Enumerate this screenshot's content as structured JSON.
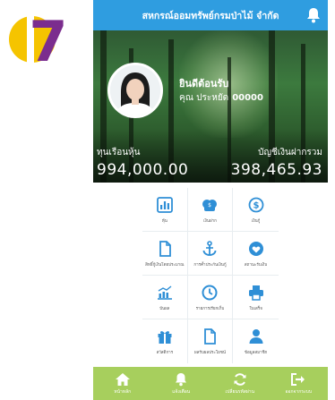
{
  "step_number": "7",
  "header": {
    "title": "สหกรณ์ออมทรัพย์กรมป่าไม้ จำกัด"
  },
  "profile": {
    "welcome": "ยินดีต้อนรับ",
    "member_prefix": "คุณ ประหยัด",
    "member_id": "00000"
  },
  "balances": {
    "share_label": "ทุนเรือนหุ้น",
    "share_value": "994,000.00",
    "loan_label": "บัญชีเงินฝากรวม",
    "loan_value": "398,465.93"
  },
  "menu": [
    {
      "label": "หุ้น",
      "icon": "bar-chart-icon"
    },
    {
      "label": "เงินฝาก",
      "icon": "money-icon"
    },
    {
      "label": "เงินกู้",
      "icon": "coin-icon"
    },
    {
      "label": "สิทธิ์กู้เงินโดยประมาณ",
      "icon": "document-icon"
    },
    {
      "label": "การค้ำประกันเงินกู้",
      "icon": "anchor-icon"
    },
    {
      "label": "สถานะรับเงิน",
      "icon": "heart-icon"
    },
    {
      "label": "ปันผล",
      "icon": "line-chart-icon"
    },
    {
      "label": "รายการเรียกเก็บ",
      "icon": "clock-icon"
    },
    {
      "label": "ใบเสร็จ",
      "icon": "printer-icon"
    },
    {
      "label": "สวัสดิการ",
      "icon": "gift-icon"
    },
    {
      "label": "ผลรับผลประโยชน์",
      "icon": "file-icon"
    },
    {
      "label": "ข้อมูลสมาชิก",
      "icon": "user-icon"
    }
  ],
  "bottom_nav": [
    {
      "label": "หน้าหลัก",
      "icon": "home-icon"
    },
    {
      "label": "แจ้งเตือน",
      "icon": "bell-icon"
    },
    {
      "label": "เปลี่ยนรหัสผ่าน",
      "icon": "refresh-icon"
    },
    {
      "label": "ออกจากระบบ",
      "icon": "logout-icon"
    }
  ],
  "colors": {
    "header_blue": "#2f9de0",
    "icon_blue": "#2f8fd6",
    "nav_green": "#a7cf5d",
    "badge_yellow": "#f5c400",
    "badge_purple": "#7b2d8e"
  }
}
